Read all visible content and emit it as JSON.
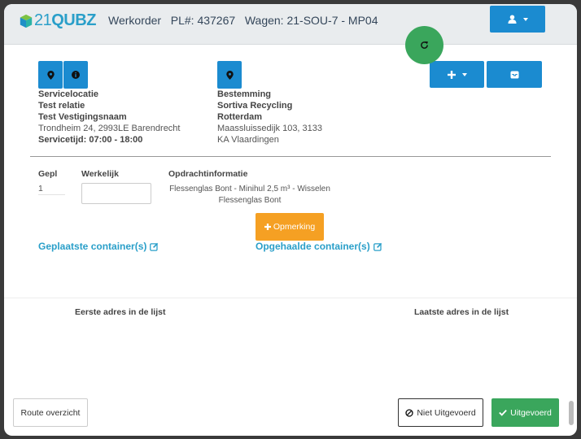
{
  "header": {
    "logo_text_light": "21",
    "logo_text_bold": "QUBZ",
    "title": "Werkorder   PL#: 437267   Wagen: 21-SOU-7 - MP04"
  },
  "colors": {
    "primary": "#1b8bd0",
    "success": "#3aa65c",
    "warning": "#f5a023",
    "link": "#2a9fc9",
    "navbar_bg": "#e9ecee"
  },
  "service": {
    "heading": "Servicelocatie",
    "relatie": "Test relatie",
    "vestiging": "Test Vestigingsnaam",
    "adres": "Trondheim 24, 2993LE Barendrecht",
    "servicetijd": "Servicetijd: 07:00 - 18:00"
  },
  "bestemming": {
    "heading": "Bestemming",
    "naam": "Sortiva Recycling",
    "plaats": "Rotterdam",
    "adres_1": "Maassluissedijk 103, 3133",
    "adres_2": "KA Vlaardingen"
  },
  "order": {
    "gepl_label": "Gepl",
    "gepl_value": "1",
    "werkelijk_label": "Werkelijk",
    "werkelijk_value": "",
    "opdracht_label": "Opdrachtinformatie",
    "opdracht_line1": "Flessenglas Bont - Minihul 2,5 m³ - Wisselen",
    "opdracht_line2": "Flessenglas Bont"
  },
  "buttons": {
    "opmerking": "Opmerking",
    "route_overzicht": "Route overzicht",
    "niet_uitgevoerd": "Niet Uitgevoerd",
    "uitgevoerd": "Uitgevoerd"
  },
  "links": {
    "geplaatste": "Geplaatste container(s)",
    "opgehaalde": "Opgehaalde container(s)"
  },
  "list": {
    "first": "Eerste adres in de lijst",
    "last": "Laatste adres in de lijst"
  },
  "icons": {
    "user": "user-icon",
    "refresh": "refresh-icon",
    "map_marker": "map-marker-icon",
    "info": "info-icon",
    "plus": "plus-icon",
    "inbox": "inbox-icon",
    "edit": "edit-icon",
    "ban": "ban-icon",
    "check": "check-icon"
  }
}
